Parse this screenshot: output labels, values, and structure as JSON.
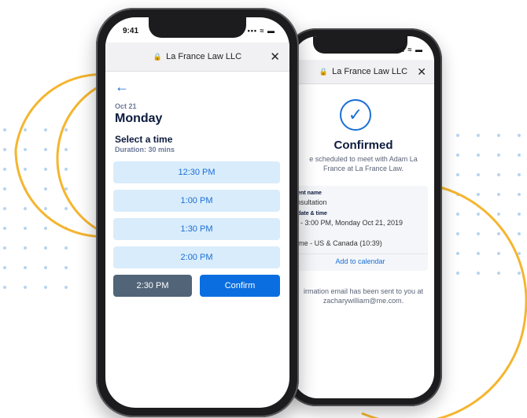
{
  "front": {
    "status_time": "9:41",
    "status_icons": "••• ≈ ▬",
    "site": "La France Law LLC",
    "close_glyph": "✕",
    "date": "Oct 21",
    "day": "Monday",
    "heading": "Select a time",
    "duration": "Duration: 30 mins",
    "slots": [
      "12:30 PM",
      "1:00 PM",
      "1:30 PM",
      "2:00 PM"
    ],
    "selected_slot": "2:30 PM",
    "confirm_label": "Confirm",
    "accent": "#0a6ee0"
  },
  "back": {
    "status_icons": "•ıl ≈ ▬",
    "site": "La France Law LLC",
    "close_glyph": "✕",
    "title": "Confirmed",
    "subtitle": "e scheduled to meet with Adam La France at La France Law.",
    "event_label": "ment name",
    "event_value": "onsultation",
    "datetime_label": "d date & time",
    "datetime_value": "M - 3:00 PM, Monday Oct 21, 2019",
    "tz_label": "ne",
    "tz_value": "Time - US & Canada (10:39)",
    "add_calendar": "Add to calendar",
    "email_note": "irmation email has been sent to you at zacharywilliam@me.com."
  },
  "icons": {
    "lock": "lock-icon",
    "back": "back-arrow-icon",
    "check": "check-circle-icon"
  },
  "colors": {
    "decor_orange": "#f5b52f",
    "decor_dots": "#b7d4ee",
    "slot_bg": "#d9ecfb",
    "selected_slot_bg": "#516478"
  }
}
